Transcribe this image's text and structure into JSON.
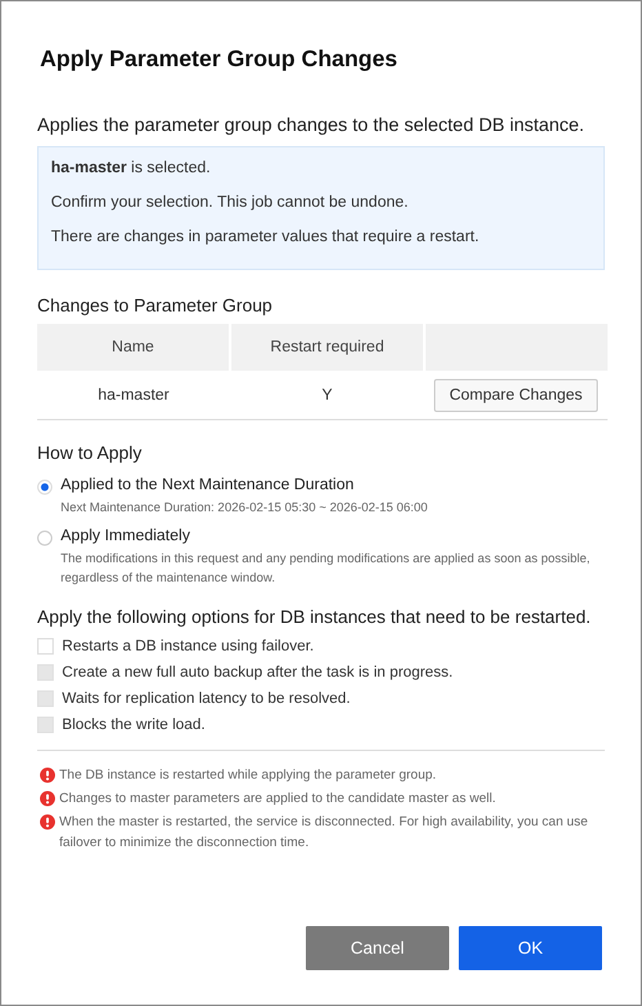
{
  "dialog": {
    "title": "Apply Parameter Group Changes"
  },
  "description": "Applies the parameter group changes to the selected DB instance.",
  "info_box": [
    "**ha-master** is selected.",
    "Confirm your selection. This job cannot be undone.",
    "There are changes in parameter values that require a restart."
  ],
  "changes": {
    "heading": "Changes to Parameter Group",
    "columns": [
      "Name",
      "Restart required"
    ],
    "rows": [
      {
        "name": "ha-master",
        "restart_required": "Y",
        "action": "Compare Changes"
      }
    ]
  },
  "how_to_apply": {
    "heading": "How to Apply",
    "options": [
      {
        "label": "Applied to the Next Maintenance Duration",
        "description": "Next Maintenance Duration: 2026-02-15 05:30 ~ 2026-02-15 06:00",
        "selected": true
      },
      {
        "label": "Apply Immediately",
        "description": "The modifications in this request and any pending modifications are applied as soon as possible, regardless of the maintenance window.",
        "selected": false
      }
    ]
  },
  "restart_options": {
    "heading": "Apply the following options for DB instances that need to be restarted.",
    "options": [
      {
        "label": "Restarts a DB instance using failover.",
        "checked": false,
        "disabled": false
      },
      {
        "label": "Create a new full auto backup after the task is in progress.",
        "checked": false,
        "disabled": true
      },
      {
        "label": "Waits for replication latency to be resolved.",
        "checked": false,
        "disabled": true
      },
      {
        "label": "Blocks the write load.",
        "checked": false,
        "disabled": true
      }
    ]
  },
  "notes": [
    "The DB instance is restarted while applying the parameter group.",
    "Changes to master parameters are applied to the candidate master as well.",
    "When the master is restarted, the service is disconnected. For high availability, you can use failover to minimize the disconnection time."
  ],
  "buttons": [
    {
      "label": "Cancel",
      "kind": "secondary"
    },
    {
      "label": "OK",
      "kind": "primary"
    }
  ]
}
